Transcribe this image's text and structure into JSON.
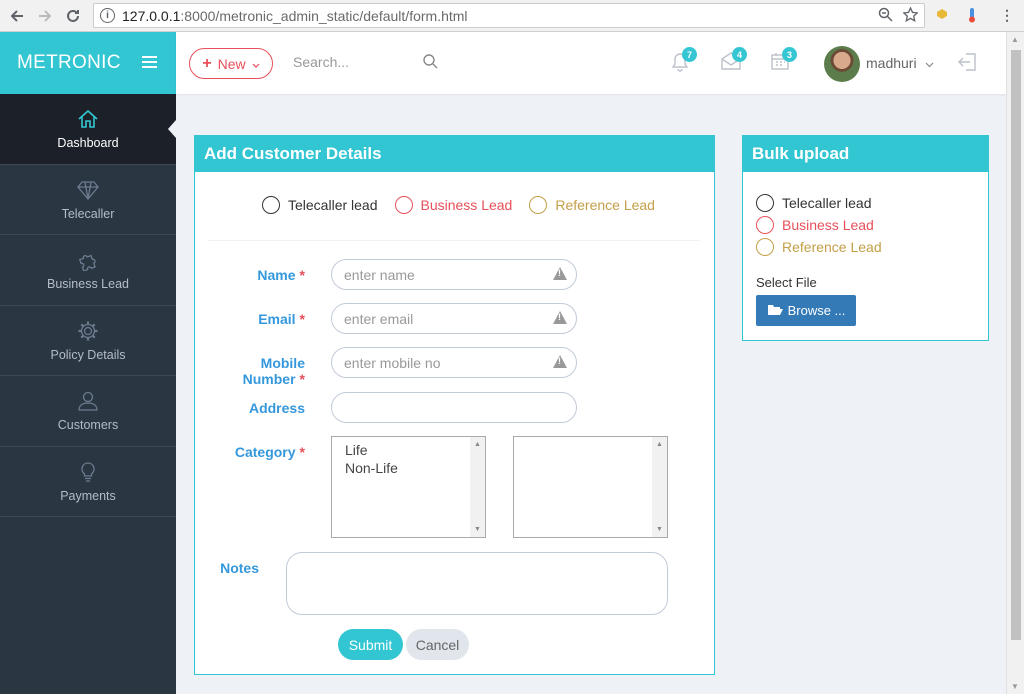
{
  "browser": {
    "url_host": "127.0.0.1",
    "url_path": ":8000/metronic_admin_static/default/form.html"
  },
  "sidebar": {
    "brand": "METRONIC",
    "items": [
      {
        "label": "Dashboard",
        "icon": "home-icon",
        "active": true
      },
      {
        "label": "Telecaller",
        "icon": "diamond-icon"
      },
      {
        "label": "Business Lead",
        "icon": "puzzle-icon"
      },
      {
        "label": "Policy Details",
        "icon": "gear-icon"
      },
      {
        "label": "Customers",
        "icon": "user-icon"
      },
      {
        "label": "Payments",
        "icon": "lightbulb-icon"
      }
    ]
  },
  "header": {
    "new_label": "New",
    "search_placeholder": "Search...",
    "notifications_count": "7",
    "inbox_count": "4",
    "tasks_count": "3",
    "username": "madhuri"
  },
  "form": {
    "title": "Add Customer Details",
    "lead_types": [
      "Telecaller lead",
      "Business Lead",
      "Reference Lead"
    ],
    "name_label": "Name",
    "name_placeholder": "enter name",
    "email_label": "Email",
    "email_placeholder": "enter email",
    "mobile_label": "Mobile Number",
    "mobile_placeholder": "enter mobile no",
    "address_label": "Address",
    "category_label": "Category",
    "required_mark": "*",
    "category_options": [
      "Life",
      "Non-Life"
    ],
    "notes_label": "Notes",
    "submit_label": "Submit",
    "cancel_label": "Cancel"
  },
  "bulk": {
    "title": "Bulk upload",
    "lead_types": [
      "Telecaller lead",
      "Business Lead",
      "Reference Lead"
    ],
    "select_file_label": "Select File",
    "browse_label": "Browse ..."
  },
  "colors": {
    "accent": "#32c5d2",
    "sidebar": "#2b3643",
    "danger": "#e7505a",
    "warning": "#c49f47",
    "label_blue": "#3598dc",
    "browse_blue": "#337ab7"
  }
}
